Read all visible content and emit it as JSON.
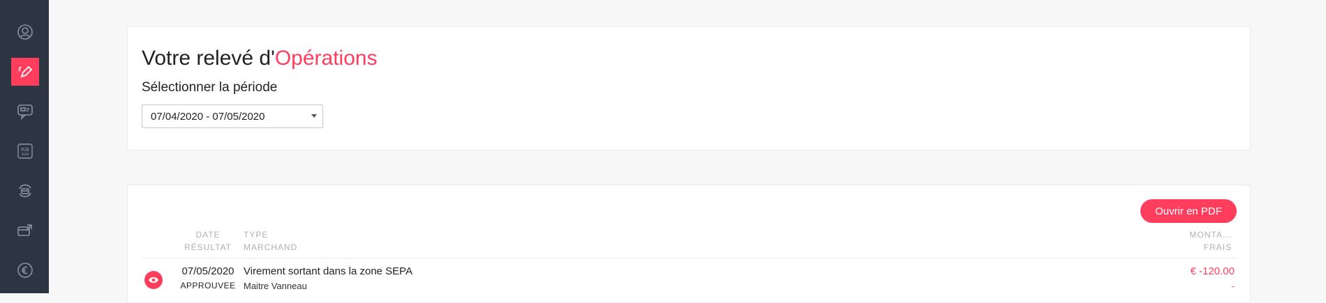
{
  "sidebar": {
    "items": [
      {
        "icon": "user-circle-icon",
        "active": false
      },
      {
        "icon": "pen-icon",
        "active": true
      },
      {
        "icon": "chat-card-icon",
        "active": false
      },
      {
        "icon": "rib-iban-icon",
        "active": false
      },
      {
        "icon": "card-refresh-icon",
        "active": false
      },
      {
        "icon": "card-transfer-icon",
        "active": false
      },
      {
        "icon": "euro-icon",
        "active": false
      }
    ]
  },
  "header": {
    "title_prefix": "Votre relevé d'",
    "title_accent": "Opérations",
    "subtitle": "Sélectionner la période",
    "period_value": "07/04/2020 - 07/05/2020"
  },
  "statement": {
    "pdf_button_label": "Ouvrir en PDF",
    "columns": {
      "date": "DATE",
      "result": "RÉSULTAT",
      "type": "TYPE",
      "merchant": "MARCHAND",
      "amount": "MONTA...",
      "fees": "FRAIS"
    },
    "rows": [
      {
        "date": "07/05/2020",
        "status": "APPROUVEE",
        "type": "Virement sortant dans la zone SEPA",
        "merchant": "Maitre Vanneau",
        "amount": "€ -120.00",
        "fees": "-"
      }
    ]
  },
  "colors": {
    "accent": "#ff3d5d",
    "sidebar_bg": "#2e3542",
    "page_bg": "#f7f7f7"
  }
}
